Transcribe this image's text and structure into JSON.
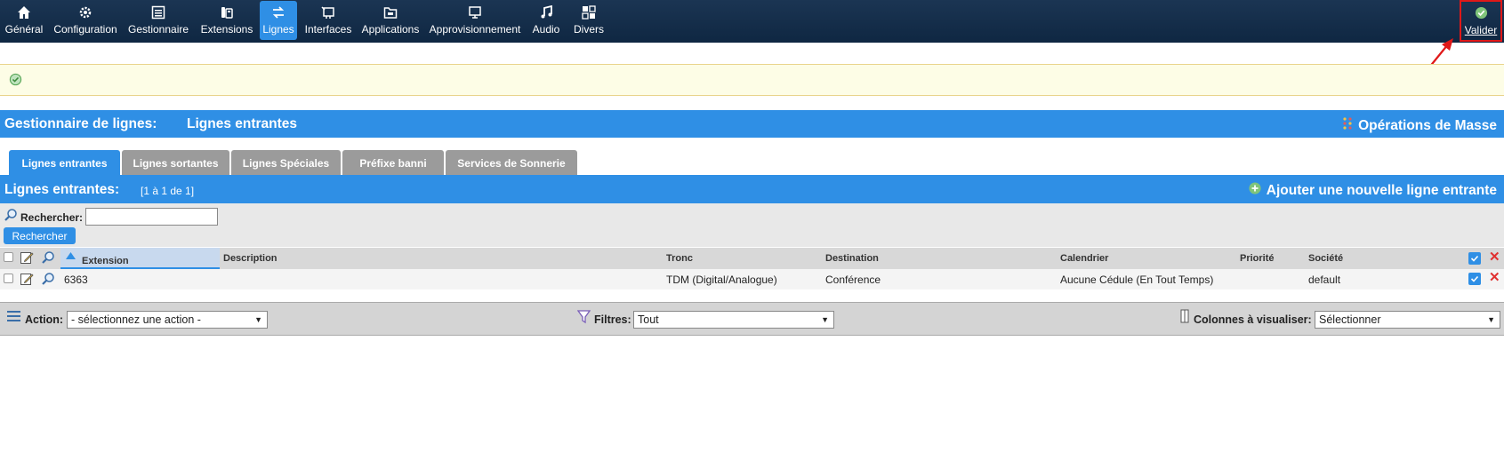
{
  "nav": {
    "items": [
      {
        "label": "Général",
        "icon": "home-icon"
      },
      {
        "label": "Configuration",
        "icon": "gear-icon"
      },
      {
        "label": "Gestionnaire",
        "icon": "list-icon"
      },
      {
        "label": "Extensions",
        "icon": "phone-icon"
      },
      {
        "label": "Lignes",
        "icon": "lines-icon"
      },
      {
        "label": "Interfaces",
        "icon": "interface-icon"
      },
      {
        "label": "Applications",
        "icon": "folder-icon"
      },
      {
        "label": "Approvisionnement",
        "icon": "provision-icon"
      },
      {
        "label": "Audio",
        "icon": "music-icon"
      },
      {
        "label": "Divers",
        "icon": "grid-icon"
      }
    ],
    "active": "Lignes",
    "valider_label": "Valider"
  },
  "section": {
    "title_prefix": "Gestionnaire de lignes:",
    "title": "Lignes entrantes",
    "mass_ops": "Opérations de Masse"
  },
  "tabs": [
    "Lignes entrantes",
    "Lignes sortantes",
    "Lignes Spéciales",
    "Préfixe banni",
    "Services de Sonnerie"
  ],
  "list": {
    "title": "Lignes entrantes:",
    "count": "[1 à 1 de 1]",
    "add_label": "Ajouter une nouvelle ligne entrante"
  },
  "search": {
    "label": "Rechercher:",
    "value": "",
    "button": "Rechercher"
  },
  "table": {
    "headers": {
      "extension": "Extension",
      "description": "Description",
      "tronc": "Tronc",
      "destination": "Destination",
      "calendrier": "Calendrier",
      "priorite": "Priorité",
      "societe": "Société"
    },
    "rows": [
      {
        "extension": "6363",
        "description": "",
        "tronc": "TDM (Digital/Analogue)",
        "destination": "Conférence",
        "calendrier": "Aucune Cédule (En Tout Temps)",
        "priorite": "",
        "societe": "default"
      }
    ]
  },
  "actions": {
    "action_label": "Action:",
    "action_value": "- sélectionnez une action -",
    "filter_label": "Filtres:",
    "filter_value": "Tout",
    "columns_label": "Colonnes à visualiser:",
    "columns_value": "Sélectionner"
  },
  "colors": {
    "nav_bg": "#12294a",
    "accent": "#2f8fe5",
    "tab_inactive": "#9b9b9b",
    "highlight_box": "#e01818",
    "message_bg": "#fdfde6"
  }
}
